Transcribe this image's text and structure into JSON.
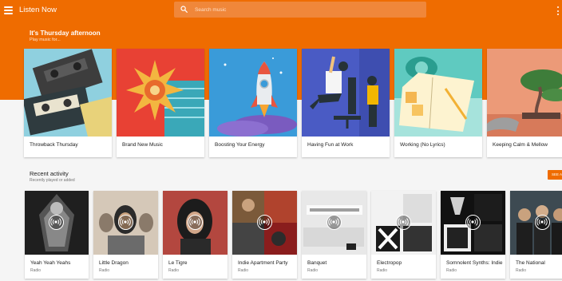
{
  "topbar": {
    "title": "Listen Now",
    "search_placeholder": "Search music"
  },
  "hero": {
    "greeting": "It's Thursday afternoon",
    "subtitle": "Play music for...",
    "cards": [
      {
        "label": "Throwback Thursday"
      },
      {
        "label": "Brand New Music"
      },
      {
        "label": "Boosting Your Energy"
      },
      {
        "label": "Having Fun at Work"
      },
      {
        "label": "Working (No Lyrics)"
      },
      {
        "label": "Keeping Calm & Mellow"
      }
    ]
  },
  "recent": {
    "title": "Recent activity",
    "subtitle": "Recently played or added",
    "see_all": "SEE ALL",
    "items": [
      {
        "title": "Yeah Yeah Yeahs",
        "type": "Radio"
      },
      {
        "title": "Little Dragon",
        "type": "Radio"
      },
      {
        "title": "Le Tigre",
        "type": "Radio"
      },
      {
        "title": "Indie Apartment Party",
        "type": "Radio"
      },
      {
        "title": "Banquet",
        "type": "Radio"
      },
      {
        "title": "Electropop",
        "type": "Radio"
      },
      {
        "title": "Somnolent Synths: Indie",
        "type": "Radio"
      },
      {
        "title": "The National",
        "type": "Radio"
      }
    ]
  },
  "colors": {
    "brand": "#ef6c00",
    "background": "#f5f5f5"
  }
}
